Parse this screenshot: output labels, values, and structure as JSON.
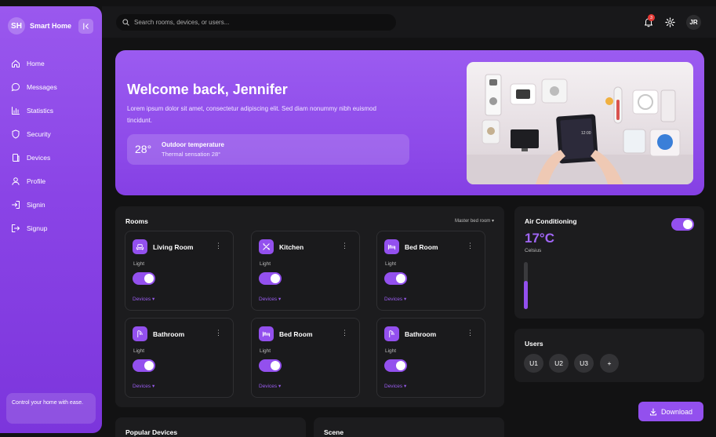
{
  "brand": {
    "logo": "SH",
    "name": "Smart Home"
  },
  "nav": [
    {
      "label": "Home",
      "icon": "home-icon"
    },
    {
      "label": "Messages",
      "icon": "message-icon"
    },
    {
      "label": "Statistics",
      "icon": "bar-chart-icon"
    },
    {
      "label": "Security",
      "icon": "shield-icon"
    },
    {
      "label": "Devices",
      "icon": "devices-icon"
    },
    {
      "label": "Profile",
      "icon": "user-icon"
    },
    {
      "label": "Signin",
      "icon": "sign-in-icon"
    },
    {
      "label": "Signup",
      "icon": "sign-up-icon"
    }
  ],
  "sidebar_promo": "Control your home with ease.",
  "topbar": {
    "search_placeholder": "Search rooms, devices, or users...",
    "notification_count": "3",
    "avatar": "JR"
  },
  "hero": {
    "title": "Welcome back, Jennifer",
    "text": "Lorem ipsum dolor sit amet, consectetur adipiscing elit. Sed diam nonummy nibh euismod tincidunt.",
    "temp_value": "28°",
    "temp_label": "Outdoor temperature",
    "temp_sub": "Thermal sensation 28°"
  },
  "rooms": {
    "title": "Rooms",
    "selector": "Master bed room",
    "cards": [
      {
        "name": "Living Room",
        "light_label": "Light",
        "light_on": true,
        "devices_label": "Devices",
        "icon": "sofa-icon"
      },
      {
        "name": "Kitchen",
        "light_label": "Light",
        "light_on": true,
        "devices_label": "Devices",
        "icon": "utensils-icon"
      },
      {
        "name": "Bed Room",
        "light_label": "Light",
        "light_on": true,
        "devices_label": "Devices",
        "icon": "bed-icon"
      },
      {
        "name": "Bathroom",
        "light_label": "Light",
        "light_on": true,
        "devices_label": "Devices",
        "icon": "shower-icon"
      },
      {
        "name": "Bed Room",
        "light_label": "Light",
        "light_on": true,
        "devices_label": "Devices",
        "icon": "bed-icon"
      },
      {
        "name": "Bathroom",
        "light_label": "Light",
        "light_on": true,
        "devices_label": "Devices",
        "icon": "shower-icon"
      }
    ]
  },
  "air_conditioning": {
    "title": "Air Conditioning",
    "temperature": "17°C",
    "unit": "Celsius",
    "enabled": true,
    "level": 0.6
  },
  "users": {
    "title": "Users",
    "list": [
      "U1",
      "U2",
      "U3",
      "+"
    ]
  },
  "popular_devices": {
    "title": "Popular Devices"
  },
  "scene": {
    "title": "Scene"
  },
  "download": {
    "label": "Download"
  },
  "colors": {
    "accent": "#9350ee",
    "panel": "#1c1c1e",
    "background": "#121213"
  }
}
